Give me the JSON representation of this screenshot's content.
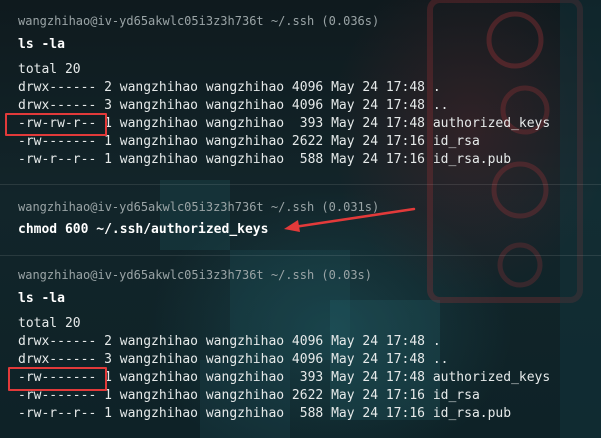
{
  "colors": {
    "highlight": "#e23a3a",
    "prompt": "#9aa4a6",
    "text": "#e6eaea"
  },
  "block1": {
    "prompt": "wangzhihao@iv-yd65akwlc05i3z3h736t ~/.ssh (0.036s)",
    "command": "ls -la",
    "output": [
      "total 20",
      "drwx------ 2 wangzhihao wangzhihao 4096 May 24 17:48 .",
      "drwx------ 3 wangzhihao wangzhihao 4096 May 24 17:48 ..",
      "-rw-rw-r-- 1 wangzhihao wangzhihao  393 May 24 17:48 authorized_keys",
      "-rw------- 1 wangzhihao wangzhihao 2622 May 24 17:16 id_rsa",
      "-rw-r--r-- 1 wangzhihao wangzhihao  588 May 24 17:16 id_rsa.pub"
    ]
  },
  "block2": {
    "prompt": "wangzhihao@iv-yd65akwlc05i3z3h736t ~/.ssh (0.031s)",
    "command": "chmod 600 ~/.ssh/authorized_keys"
  },
  "block3": {
    "prompt": "wangzhihao@iv-yd65akwlc05i3z3h736t ~/.ssh (0.03s)",
    "command": "ls -la",
    "output": [
      "total 20",
      "drwx------ 2 wangzhihao wangzhihao 4096 May 24 17:48 .",
      "drwx------ 3 wangzhihao wangzhihao 4096 May 24 17:48 ..",
      "-rw------- 1 wangzhihao wangzhihao  393 May 24 17:48 authorized_keys",
      "-rw------- 1 wangzhihao wangzhihao 2622 May 24 17:16 id_rsa",
      "-rw-r--r-- 1 wangzhihao wangzhihao  588 May 24 17:16 id_rsa.pub"
    ]
  }
}
